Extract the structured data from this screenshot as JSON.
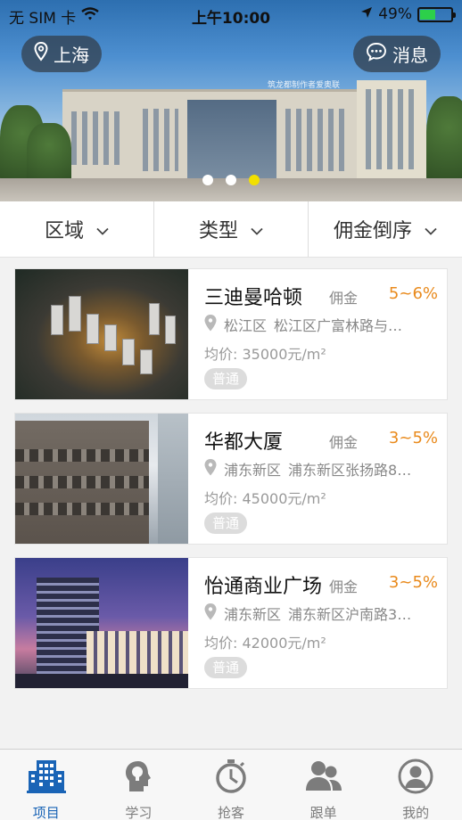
{
  "status_bar": {
    "carrier": "无 SIM 卡",
    "time": "上午10:00",
    "battery": "49%",
    "battery_level": 0.49
  },
  "banner": {
    "location": "上海",
    "message_label": "消息",
    "watermark": "筑龙都制作者爱奥联",
    "page_count": 3,
    "active_page": 3
  },
  "filters": [
    {
      "label": "区域"
    },
    {
      "label": "类型"
    },
    {
      "label": "佣金倒序"
    }
  ],
  "listings": [
    {
      "name": "三迪曼哈顿",
      "commission_label": "佣金",
      "commission": "5~6%",
      "district": "松江区",
      "address": "松江区广富林路与…",
      "price": "均价: 35000元/m²",
      "badge": "普通"
    },
    {
      "name": "华都大厦",
      "commission_label": "佣金",
      "commission": "3~5%",
      "district": "浦东新区",
      "address": "浦东新区张扬路8…",
      "price": "均价: 45000元/m²",
      "badge": "普通"
    },
    {
      "name": "怡通商业广场",
      "commission_label": "佣金",
      "commission": "3~5%",
      "district": "浦东新区",
      "address": "浦东新区沪南路3…",
      "price": "均价: 42000元/m²",
      "badge": "普通"
    }
  ],
  "tabs": [
    {
      "label": "项目",
      "icon": "building-icon",
      "active": true
    },
    {
      "label": "学习",
      "icon": "lightbulb-head-icon",
      "active": false
    },
    {
      "label": "抢客",
      "icon": "stopwatch-icon",
      "active": false
    },
    {
      "label": "跟单",
      "icon": "people-icon",
      "active": false
    },
    {
      "label": "我的",
      "icon": "person-icon",
      "active": false
    }
  ],
  "colors": {
    "accent": "#1a64b6",
    "commission": "#e98a1c",
    "active_dot": "#f2e000",
    "battery": "#2cd04a"
  }
}
